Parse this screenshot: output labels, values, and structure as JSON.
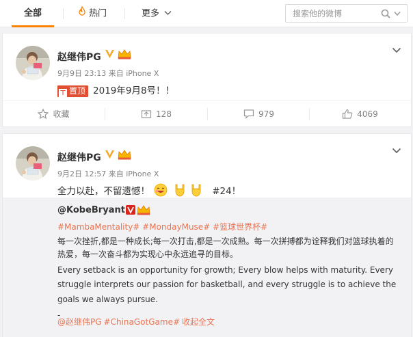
{
  "tabs": {
    "all": "全部",
    "hot": "热门",
    "more": "更多"
  },
  "search": {
    "placeholder": "搜索他的微博"
  },
  "posts": [
    {
      "author": "赵继伟PG",
      "date": "9月9日 23:13",
      "source": "来自 iPhone X",
      "pin_label": "置顶",
      "text": "2019年9月8号！！",
      "actions": {
        "favorite": "收藏",
        "repost": "128",
        "comment": "979",
        "like": "4069"
      }
    },
    {
      "author": "赵继伟PG",
      "date": "9月2日 12:57",
      "source": "来自 iPhone X",
      "text": "全力以赴，不留遗憾！",
      "text_tag": "#24！",
      "quote": {
        "author": "@KobeBryant",
        "tags": "#MambaMentality# #MondayMuse# #篮球世界杯#",
        "zh_text": "每一次挫折,都是一种成长;每一次打击,都是一次成熟。每一次拼搏都为诠释我们对篮球执着的热爱，每一次奋斗都为实现心中永远追寻的目标。",
        "en_text": "Every setback is an opportunity for growth; Every blow helps with maturity. Every struggle interprets our passion for basketball, and every struggle is to achieve the goals we always pursue.",
        "dash": "-",
        "mention": "@赵继伟PG",
        "foot_tag": "#ChinaGotGame#",
        "fold": "收起全文"
      }
    }
  ],
  "colors": {
    "accent_orange": "#ff8200",
    "link_orange": "#eb7350",
    "pin_red": "#e14e34",
    "verified_gold": "#f5a623"
  },
  "icons": [
    "fire-icon",
    "chevron-down-icon",
    "search-icon",
    "verified-icon",
    "crown-icon",
    "star-icon",
    "repost-icon",
    "comment-icon",
    "like-icon",
    "emoji-laugh-icon",
    "emoji-rock-hand-icon"
  ]
}
